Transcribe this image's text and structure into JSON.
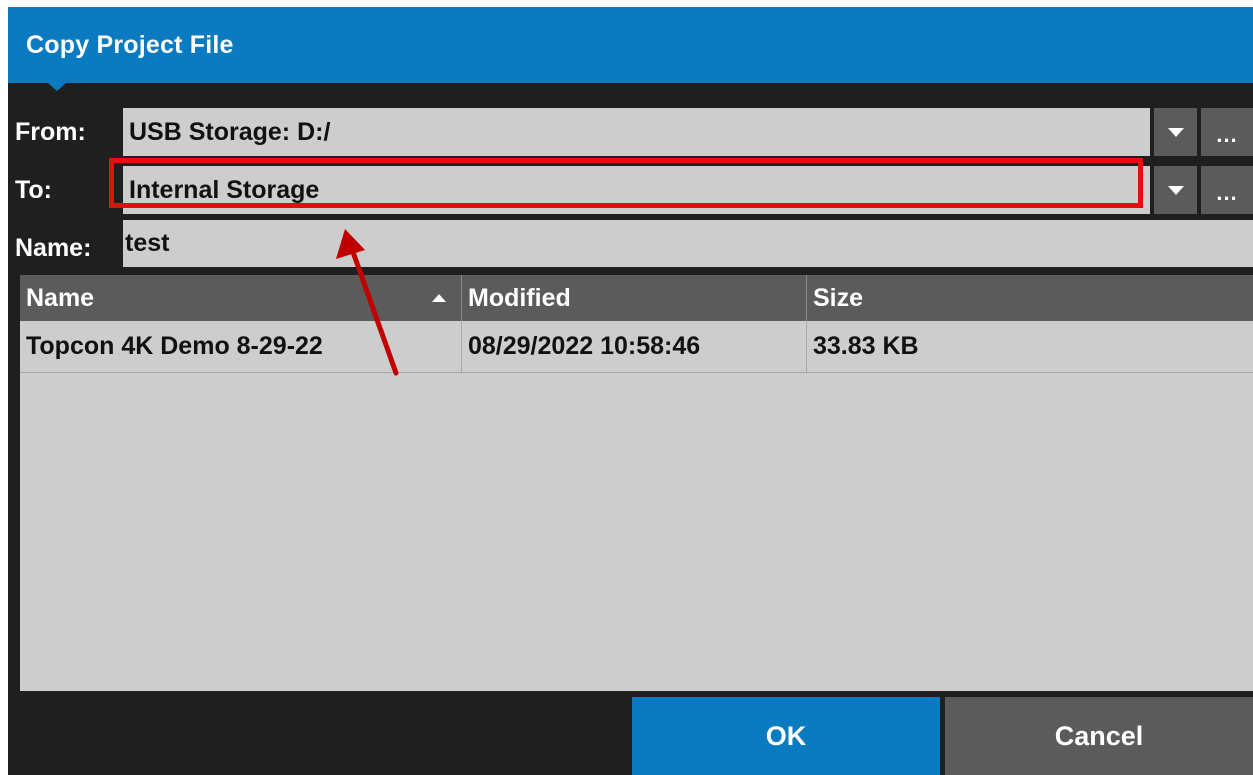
{
  "dialog": {
    "title": "Copy Project File"
  },
  "form": {
    "from_label": "From:",
    "from_value": "USB Storage: D:/",
    "to_label": "To:",
    "to_value": "Internal Storage",
    "name_label": "Name:",
    "name_value": "test",
    "browse_label": "..."
  },
  "table": {
    "columns": [
      "Name",
      "Modified",
      "Size"
    ],
    "rows": [
      [
        "Topcon 4K Demo 8-29-22",
        "08/29/2022 10:58:46",
        "33.83 KB"
      ]
    ]
  },
  "buttons": {
    "ok": "OK",
    "cancel": "Cancel"
  },
  "colors": {
    "accent": "#0a7bc1",
    "highlight": "#e01010",
    "annotation_arrow": "#c00000"
  },
  "icons": {
    "dropdown": "chevron-down-icon",
    "sort": "sort-ascending-icon",
    "annotation": "red-arrow-annotation"
  }
}
